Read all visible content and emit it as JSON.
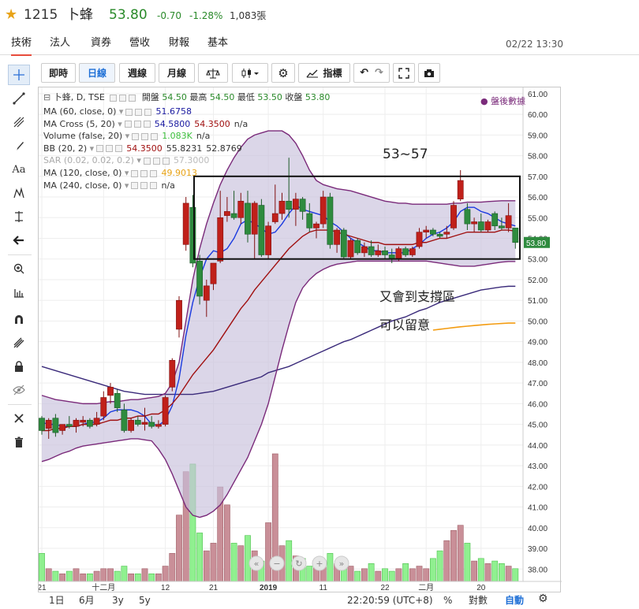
{
  "header": {
    "star_icon": "star-icon",
    "symbol": "1215",
    "name": "卜蜂",
    "price": "53.80",
    "change": "-0.70",
    "change_pct": "-1.28%",
    "volume": "1,083張",
    "price_color": "#2a8a2a"
  },
  "tabs": [
    "技術",
    "法人",
    "資券",
    "營收",
    "財報",
    "基本"
  ],
  "timestamp": "02/22 13:30",
  "left_toolbar": [
    "crosshair-icon",
    "trendline-icon",
    "pitchfork-icon",
    "brush-icon",
    "text-icon",
    "pattern-icon",
    "measure-icon",
    "arrow-icon",
    "zoom-icon",
    "ruler-icon",
    "magnet-icon",
    "lock-draw-icon",
    "lock-icon",
    "hide-icon",
    "remove-tools-icon",
    "trash-icon"
  ],
  "toolbar": {
    "intraday": "即時",
    "daily": "日線",
    "weekly": "週線",
    "monthly": "月線",
    "compare_icon": "scale-icon",
    "candle_icon": "candlestick-icon",
    "settings_icon": "gear-icon",
    "indicators": "指標",
    "undo_icon": "undo-icon",
    "redo_icon": "redo-icon",
    "fullscreen_icon": "fullscreen-icon",
    "snapshot_icon": "camera-icon"
  },
  "legend": {
    "main": {
      "name": "卜蜂, D, TSE",
      "open_label": "開盤",
      "open": "54.50",
      "high_label": "最高",
      "high": "54.50",
      "low_label": "最低",
      "low": "53.50",
      "close_label": "收盤",
      "close": "53.80"
    },
    "badge": "● 盤後數據",
    "rows": [
      {
        "name": "MA (60, close, 0)",
        "vals": [
          "51.6758"
        ],
        "colors": [
          "#1a1aa0"
        ]
      },
      {
        "name": "MA Cross (5, 20)",
        "vals": [
          "54.5800",
          "54.3500",
          "n/a"
        ],
        "colors": [
          "#1a1aa0",
          "#a01010",
          "#333333"
        ]
      },
      {
        "name": "Volume (false, 20)",
        "vals": [
          "1.083K",
          "n/a"
        ],
        "colors": [
          "#3cbf3c",
          "#333333"
        ]
      },
      {
        "name": "BB (20, 2)",
        "vals": [
          "54.3500",
          "55.8231",
          "52.8769"
        ],
        "colors": [
          "#a01010",
          "#333333",
          "#333333"
        ]
      },
      {
        "name": "SAR (0.02, 0.02, 0.2)",
        "vals": [
          "57.3000"
        ],
        "colors": [
          "#bbbbbb"
        ]
      },
      {
        "name": "MA (120, close, 0)",
        "vals": [
          "49.9013"
        ],
        "colors": [
          "#e8a317"
        ]
      },
      {
        "name": "MA (240, close, 0)",
        "vals": [
          "n/a"
        ],
        "colors": [
          "#333333"
        ]
      }
    ]
  },
  "annotations": {
    "range_text": "53~57",
    "note_line1": "又會到支撐區",
    "note_line2": "可以留意"
  },
  "bottom_bar": {
    "ranges": [
      "1日",
      "6月",
      "3y",
      "5y"
    ],
    "time": "22:20:59 (UTC+8)",
    "pct": "%",
    "log": "對數",
    "auto": "自動",
    "settings_icon": "gear-icon"
  },
  "chart_data": {
    "type": "candlestick",
    "y_ticks": [
      38,
      39,
      40,
      41,
      42,
      43,
      44,
      45,
      46,
      47,
      48,
      49,
      50,
      51,
      52,
      53,
      54,
      55,
      56,
      57,
      58,
      59,
      60,
      61
    ],
    "ylim": [
      37.4,
      61.3
    ],
    "last_price_label": "53.80",
    "x_tick_labels": [
      {
        "label": "21",
        "i": 0
      },
      {
        "label": "十二月",
        "i": 9
      },
      {
        "label": "12",
        "i": 18
      },
      {
        "label": "21",
        "i": 25
      },
      {
        "label": "2019",
        "i": 33
      },
      {
        "label": "11",
        "i": 41
      },
      {
        "label": "22",
        "i": 50
      },
      {
        "label": "二月",
        "i": 56
      },
      {
        "label": "20",
        "i": 64
      }
    ],
    "candles": [
      {
        "o": 45.3,
        "h": 45.4,
        "l": 44.5,
        "c": 44.7
      },
      {
        "o": 44.8,
        "h": 45.3,
        "l": 44.3,
        "c": 45.2
      },
      {
        "o": 45.3,
        "h": 45.5,
        "l": 44.4,
        "c": 44.6
      },
      {
        "o": 44.7,
        "h": 45.0,
        "l": 44.5,
        "c": 45.0
      },
      {
        "o": 45.0,
        "h": 45.4,
        "l": 44.8,
        "c": 44.9
      },
      {
        "o": 44.9,
        "h": 45.3,
        "l": 44.6,
        "c": 45.2
      },
      {
        "o": 45.1,
        "h": 45.4,
        "l": 44.9,
        "c": 45.2
      },
      {
        "o": 45.2,
        "h": 45.3,
        "l": 44.8,
        "c": 44.9
      },
      {
        "o": 45.0,
        "h": 45.6,
        "l": 44.9,
        "c": 45.3
      },
      {
        "o": 45.4,
        "h": 46.6,
        "l": 45.2,
        "c": 46.3
      },
      {
        "o": 46.4,
        "h": 47.0,
        "l": 46.0,
        "c": 46.8
      },
      {
        "o": 46.5,
        "h": 46.7,
        "l": 45.6,
        "c": 45.8
      },
      {
        "o": 45.7,
        "h": 46.0,
        "l": 44.6,
        "c": 44.7
      },
      {
        "o": 44.7,
        "h": 45.3,
        "l": 44.6,
        "c": 45.2
      },
      {
        "o": 45.2,
        "h": 45.4,
        "l": 44.9,
        "c": 45.0
      },
      {
        "o": 45.0,
        "h": 45.8,
        "l": 44.7,
        "c": 45.1
      },
      {
        "o": 45.1,
        "h": 45.4,
        "l": 44.8,
        "c": 44.9
      },
      {
        "o": 44.9,
        "h": 45.2,
        "l": 44.8,
        "c": 45.0
      },
      {
        "o": 45.0,
        "h": 46.4,
        "l": 44.9,
        "c": 46.3
      },
      {
        "o": 46.8,
        "h": 48.2,
        "l": 46.6,
        "c": 48.1
      },
      {
        "o": 49.6,
        "h": 51.2,
        "l": 49.2,
        "c": 51.0
      },
      {
        "o": 53.7,
        "h": 56.0,
        "l": 53.4,
        "c": 55.7
      },
      {
        "o": 55.5,
        "h": 56.1,
        "l": 52.6,
        "c": 52.8
      },
      {
        "o": 52.9,
        "h": 53.2,
        "l": 50.8,
        "c": 51.2
      },
      {
        "o": 51.0,
        "h": 52.0,
        "l": 50.2,
        "c": 51.7
      },
      {
        "o": 51.8,
        "h": 52.8,
        "l": 51.5,
        "c": 52.8
      },
      {
        "o": 52.9,
        "h": 56.3,
        "l": 52.8,
        "c": 55.0
      },
      {
        "o": 55.1,
        "h": 56.0,
        "l": 54.8,
        "c": 55.3
      },
      {
        "o": 55.2,
        "h": 56.3,
        "l": 54.9,
        "c": 55.0
      },
      {
        "o": 55.0,
        "h": 56.2,
        "l": 54.7,
        "c": 55.8
      },
      {
        "o": 55.7,
        "h": 56.3,
        "l": 53.8,
        "c": 54.2
      },
      {
        "o": 54.2,
        "h": 55.8,
        "l": 53.0,
        "c": 55.7
      },
      {
        "o": 55.6,
        "h": 55.9,
        "l": 53.1,
        "c": 53.2
      },
      {
        "o": 53.2,
        "h": 54.8,
        "l": 53.0,
        "c": 54.6
      },
      {
        "o": 54.8,
        "h": 56.6,
        "l": 54.7,
        "c": 55.2
      },
      {
        "o": 55.2,
        "h": 56.2,
        "l": 54.9,
        "c": 55.8
      },
      {
        "o": 55.8,
        "h": 57.9,
        "l": 55.0,
        "c": 55.4
      },
      {
        "o": 55.4,
        "h": 56.2,
        "l": 54.6,
        "c": 55.9
      },
      {
        "o": 55.9,
        "h": 56.0,
        "l": 54.9,
        "c": 55.3
      },
      {
        "o": 55.2,
        "h": 55.7,
        "l": 54.3,
        "c": 54.5
      },
      {
        "o": 54.5,
        "h": 54.8,
        "l": 54.0,
        "c": 54.7
      },
      {
        "o": 54.7,
        "h": 56.3,
        "l": 54.5,
        "c": 56.0
      },
      {
        "o": 56.0,
        "h": 56.2,
        "l": 53.5,
        "c": 53.7
      },
      {
        "o": 53.7,
        "h": 54.5,
        "l": 53.3,
        "c": 54.4
      },
      {
        "o": 54.4,
        "h": 54.5,
        "l": 53.0,
        "c": 53.1
      },
      {
        "o": 53.1,
        "h": 54.0,
        "l": 53.0,
        "c": 53.9
      },
      {
        "o": 53.9,
        "h": 54.0,
        "l": 53.2,
        "c": 53.3
      },
      {
        "o": 53.3,
        "h": 53.8,
        "l": 53.1,
        "c": 53.6
      },
      {
        "o": 53.6,
        "h": 53.9,
        "l": 53.1,
        "c": 53.2
      },
      {
        "o": 53.2,
        "h": 53.7,
        "l": 53.1,
        "c": 53.4
      },
      {
        "o": 53.4,
        "h": 53.6,
        "l": 53.0,
        "c": 53.2
      },
      {
        "o": 53.2,
        "h": 53.5,
        "l": 52.8,
        "c": 53.0
      },
      {
        "o": 53.0,
        "h": 53.6,
        "l": 52.9,
        "c": 53.5
      },
      {
        "o": 53.5,
        "h": 53.6,
        "l": 53.1,
        "c": 53.2
      },
      {
        "o": 53.2,
        "h": 53.6,
        "l": 53.1,
        "c": 53.5
      },
      {
        "o": 53.6,
        "h": 54.5,
        "l": 53.5,
        "c": 54.3
      },
      {
        "o": 54.3,
        "h": 54.6,
        "l": 54.0,
        "c": 54.4
      },
      {
        "o": 54.4,
        "h": 54.5,
        "l": 54.1,
        "c": 54.2
      },
      {
        "o": 54.2,
        "h": 54.3,
        "l": 54.0,
        "c": 54.1
      },
      {
        "o": 54.2,
        "h": 54.6,
        "l": 54.0,
        "c": 54.3
      },
      {
        "o": 54.5,
        "h": 55.8,
        "l": 54.4,
        "c": 55.6
      },
      {
        "o": 55.9,
        "h": 57.3,
        "l": 55.8,
        "c": 56.8
      },
      {
        "o": 55.4,
        "h": 55.7,
        "l": 54.4,
        "c": 54.7
      },
      {
        "o": 54.7,
        "h": 55.0,
        "l": 54.3,
        "c": 54.8
      },
      {
        "o": 54.8,
        "h": 55.2,
        "l": 54.3,
        "c": 54.4
      },
      {
        "o": 54.4,
        "h": 54.9,
        "l": 54.3,
        "c": 54.8
      },
      {
        "o": 55.2,
        "h": 55.3,
        "l": 54.4,
        "c": 54.6
      },
      {
        "o": 54.6,
        "h": 55.0,
        "l": 54.4,
        "c": 54.5
      },
      {
        "o": 54.5,
        "h": 55.7,
        "l": 54.3,
        "c": 55.1
      },
      {
        "o": 54.5,
        "h": 54.5,
        "l": 53.5,
        "c": 53.8
      }
    ],
    "volume": [
      1.1,
      0.5,
      0.4,
      0.3,
      0.4,
      0.5,
      0.3,
      0.3,
      0.4,
      0.5,
      0.5,
      0.4,
      0.6,
      0.3,
      0.3,
      0.5,
      0.3,
      0.3,
      0.6,
      1.1,
      2.6,
      4.3,
      4.6,
      1.9,
      1.2,
      1.5,
      3.7,
      3.0,
      1.5,
      1.4,
      1.8,
      1.2,
      0.8,
      2.3,
      5.0,
      1.4,
      1.6,
      1.0,
      0.9,
      0.6,
      0.7,
      0.8,
      1.1,
      0.7,
      0.5,
      0.6,
      0.4,
      0.5,
      0.7,
      0.4,
      0.5,
      0.4,
      0.5,
      0.7,
      0.5,
      0.6,
      0.5,
      0.9,
      1.2,
      1.6,
      2.0,
      2.2,
      1.5,
      0.8,
      0.9,
      0.7,
      0.8,
      0.7,
      0.6,
      0.5
    ],
    "volume_max": 5.0,
    "series": [
      {
        "name": "MA 60",
        "color": "#3a2a7a",
        "values": [
          47.8,
          47.7,
          47.6,
          47.5,
          47.4,
          47.3,
          47.2,
          47.1,
          47.0,
          46.9,
          46.8,
          46.7,
          46.6,
          46.55,
          46.5,
          46.45,
          46.45,
          46.45,
          46.45,
          46.45,
          46.45,
          46.45,
          46.45,
          46.5,
          46.55,
          46.6,
          46.7,
          46.8,
          46.9,
          47.0,
          47.1,
          47.2,
          47.3,
          47.5,
          47.6,
          47.7,
          47.8,
          47.95,
          48.1,
          48.25,
          48.4,
          48.55,
          48.7,
          48.85,
          49.0,
          49.1,
          49.25,
          49.4,
          49.55,
          49.7,
          49.85,
          50.0,
          50.1,
          50.2,
          50.35,
          50.5,
          50.6,
          50.75,
          50.9,
          51.0,
          51.1,
          51.2,
          51.3,
          51.4,
          51.5,
          51.55,
          51.6,
          51.65,
          51.68,
          51.68
        ]
      },
      {
        "name": "MA 5",
        "color": "#1a3ae0",
        "values": [
          45.1,
          45.0,
          45.0,
          44.9,
          44.9,
          44.9,
          45.0,
          45.1,
          45.1,
          45.3,
          45.6,
          45.7,
          45.7,
          45.7,
          45.6,
          45.4,
          45.0,
          44.95,
          45.2,
          45.9,
          47.2,
          49.3,
          50.9,
          52.1,
          53.0,
          53.4,
          53.3,
          53.5,
          54.0,
          54.7,
          54.9,
          54.7,
          54.5,
          54.2,
          54.3,
          54.7,
          55.2,
          55.6,
          55.4,
          55.3,
          55.2,
          55.1,
          54.8,
          54.6,
          54.3,
          54.0,
          53.8,
          53.6,
          53.4,
          53.4,
          53.3,
          53.3,
          53.3,
          53.3,
          53.5,
          53.7,
          54.0,
          54.2,
          54.3,
          54.5,
          54.8,
          55.3,
          55.5,
          55.5,
          55.3,
          55.2,
          55.0,
          54.8,
          54.7,
          54.6
        ]
      },
      {
        "name": "MA 20",
        "color": "#a01010",
        "values": [
          44.7,
          44.7,
          44.8,
          44.8,
          44.9,
          44.9,
          45.0,
          45.0,
          45.0,
          45.1,
          45.2,
          45.2,
          45.3,
          45.3,
          45.4,
          45.4,
          45.5,
          45.5,
          45.7,
          46.0,
          46.4,
          46.9,
          47.4,
          47.8,
          48.2,
          48.6,
          49.1,
          49.6,
          50.1,
          50.6,
          51.0,
          51.5,
          51.9,
          52.3,
          52.7,
          53.1,
          53.5,
          53.8,
          54.1,
          54.3,
          54.4,
          54.4,
          54.4,
          54.3,
          54.2,
          54.1,
          54.0,
          53.9,
          53.8,
          53.8,
          53.7,
          53.7,
          53.7,
          53.7,
          53.7,
          53.8,
          53.8,
          53.9,
          54.0,
          54.0,
          54.1,
          54.2,
          54.3,
          54.3,
          54.3,
          54.3,
          54.3,
          54.4,
          54.4,
          54.35
        ]
      },
      {
        "name": "BB upper",
        "color": "#7a2a7a",
        "values": [
          46.4,
          46.3,
          46.2,
          46.15,
          46.1,
          46.05,
          46.0,
          46.0,
          46.0,
          46.05,
          46.1,
          46.1,
          46.15,
          46.2,
          46.2,
          46.25,
          46.3,
          46.35,
          46.5,
          47.0,
          48.0,
          50.0,
          52.0,
          53.5,
          54.7,
          55.7,
          56.6,
          57.3,
          57.9,
          58.4,
          58.8,
          59.0,
          59.1,
          59.2,
          59.2,
          59.2,
          59.0,
          58.6,
          58.0,
          57.3,
          56.8,
          56.6,
          56.5,
          56.4,
          56.35,
          56.3,
          56.2,
          56.1,
          56.0,
          55.9,
          55.8,
          55.75,
          55.7,
          55.7,
          55.65,
          55.65,
          55.65,
          55.65,
          55.65,
          55.65,
          55.7,
          55.7,
          55.75,
          55.75,
          55.75,
          55.78,
          55.8,
          55.82,
          55.82,
          55.82
        ]
      },
      {
        "name": "BB lower",
        "color": "#7a2a7a",
        "values": [
          43.2,
          43.3,
          43.45,
          43.6,
          43.7,
          43.85,
          43.95,
          44.0,
          44.05,
          44.1,
          44.15,
          44.2,
          44.25,
          44.3,
          44.3,
          44.25,
          44.2,
          43.8,
          43.3,
          42.6,
          41.8,
          41.0,
          40.6,
          40.5,
          40.6,
          40.8,
          41.1,
          41.6,
          42.2,
          42.8,
          43.4,
          44.2,
          45.0,
          46.0,
          47.3,
          48.6,
          49.8,
          50.9,
          51.6,
          52.0,
          52.3,
          52.5,
          52.65,
          52.75,
          52.8,
          52.85,
          52.9,
          52.9,
          52.9,
          52.9,
          52.9,
          52.9,
          52.9,
          52.9,
          52.9,
          52.9,
          52.9,
          52.85,
          52.8,
          52.75,
          52.7,
          52.65,
          52.65,
          52.65,
          52.7,
          52.75,
          52.8,
          52.85,
          52.88,
          52.88
        ]
      },
      {
        "name": "MA 120",
        "color": "#f39c12",
        "values": [
          null,
          null,
          null,
          null,
          null,
          null,
          null,
          null,
          null,
          null,
          null,
          null,
          null,
          null,
          null,
          null,
          null,
          null,
          null,
          null,
          null,
          null,
          null,
          null,
          null,
          null,
          null,
          null,
          null,
          null,
          null,
          null,
          null,
          null,
          null,
          null,
          null,
          null,
          null,
          null,
          null,
          null,
          null,
          null,
          null,
          null,
          null,
          null,
          null,
          null,
          null,
          null,
          null,
          null,
          null,
          null,
          null,
          49.56,
          49.6,
          49.64,
          49.68,
          49.72,
          49.75,
          49.78,
          49.81,
          49.84,
          49.86,
          49.88,
          49.9,
          49.9
        ]
      }
    ]
  }
}
